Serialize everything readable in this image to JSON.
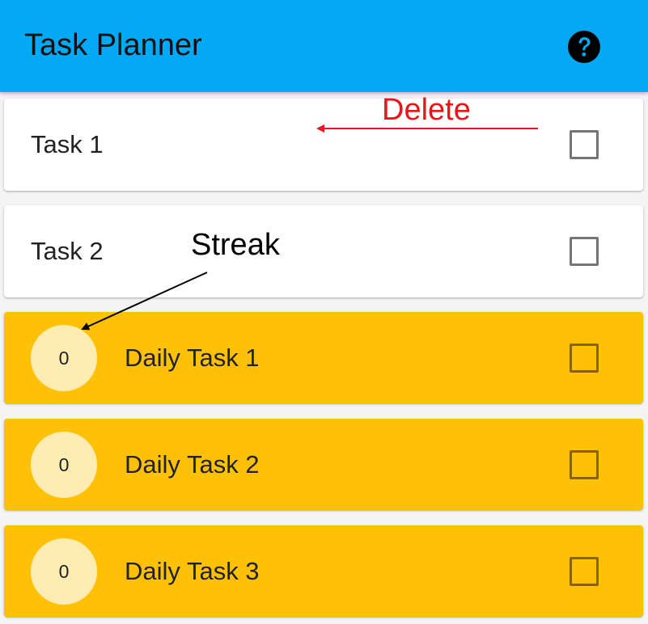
{
  "appbar": {
    "title": "Task Planner",
    "help_icon": "help-circle-icon",
    "background_color": "#03a9f4"
  },
  "tasks": [
    {
      "label": "Task 1",
      "checked": false,
      "type": "normal"
    },
    {
      "label": "Task 2",
      "checked": false,
      "type": "normal"
    }
  ],
  "daily_tasks": [
    {
      "label": "Daily Task 1",
      "streak": "0",
      "checked": false
    },
    {
      "label": "Daily Task 2",
      "streak": "0",
      "checked": false
    },
    {
      "label": "Daily Task 3",
      "streak": "0",
      "checked": false
    }
  ],
  "annotations": {
    "delete": {
      "text": "Delete",
      "color": "#e8161b"
    },
    "streak": {
      "text": "Streak",
      "color": "#000000"
    }
  },
  "colors": {
    "daily_card": "#ffc107",
    "streak_badge": "#ffecb3",
    "normal_card": "#ffffff"
  }
}
